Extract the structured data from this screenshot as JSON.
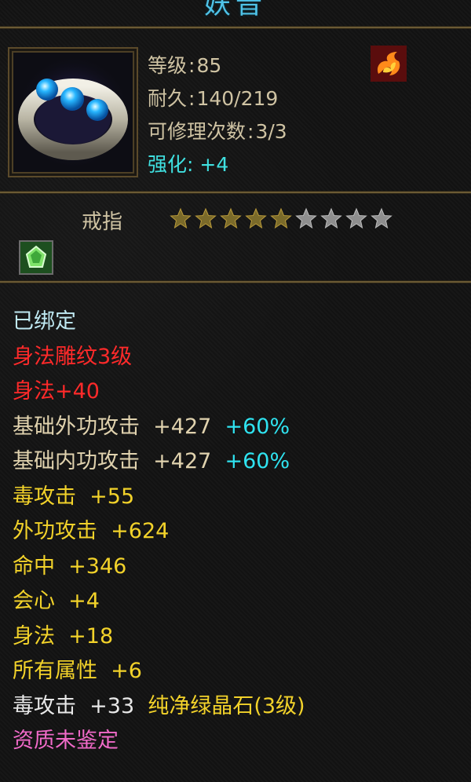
{
  "item": {
    "name": "妖音",
    "type": "戒指",
    "icon": "ring-with-blue-gems-icon",
    "emblem": "fire-element-icon",
    "gem_socket": "green-gem-icon",
    "stars": {
      "total": 9,
      "filled": 5
    },
    "stats": {
      "level_label": "等级",
      "level_value": "85",
      "durability_label": "耐久",
      "durability_value": "140/219",
      "repair_label": "可修理次数",
      "repair_value": "3/3",
      "refine_label": "强化:",
      "refine_value": "+4"
    }
  },
  "attributes": [
    {
      "parts": [
        {
          "text": "已绑定",
          "color": "lightcyan"
        }
      ]
    },
    {
      "parts": [
        {
          "text": "身法雕纹3级",
          "color": "red"
        }
      ]
    },
    {
      "parts": [
        {
          "text": "身法+40",
          "color": "red"
        }
      ]
    },
    {
      "parts": [
        {
          "text": "基础外功攻击",
          "color": "beige"
        },
        {
          "text": "  +427",
          "color": "beige"
        },
        {
          "text": "  +60%",
          "color": "cyan"
        }
      ]
    },
    {
      "parts": [
        {
          "text": "基础内功攻击",
          "color": "beige"
        },
        {
          "text": "  +427",
          "color": "beige"
        },
        {
          "text": "  +60%",
          "color": "cyan"
        }
      ]
    },
    {
      "parts": [
        {
          "text": "毒攻击",
          "color": "yellow"
        },
        {
          "text": "  +55",
          "color": "yellow"
        }
      ]
    },
    {
      "parts": [
        {
          "text": "外功攻击",
          "color": "yellow"
        },
        {
          "text": "  +624",
          "color": "yellow"
        }
      ]
    },
    {
      "parts": [
        {
          "text": "命中",
          "color": "yellow"
        },
        {
          "text": "  +346",
          "color": "yellow"
        }
      ]
    },
    {
      "parts": [
        {
          "text": "会心",
          "color": "yellow"
        },
        {
          "text": "  +4",
          "color": "yellow"
        }
      ]
    },
    {
      "parts": [
        {
          "text": "身法",
          "color": "yellow"
        },
        {
          "text": "  +18",
          "color": "yellow"
        }
      ]
    },
    {
      "parts": [
        {
          "text": "所有属性",
          "color": "yellow"
        },
        {
          "text": "  +6",
          "color": "yellow"
        }
      ]
    },
    {
      "parts": [
        {
          "text": "毒攻击",
          "color": "white"
        },
        {
          "text": "  +33",
          "color": "white"
        },
        {
          "text": "  纯净绿晶石(3级)",
          "color": "yellow"
        }
      ]
    },
    {
      "parts": [
        {
          "text": "资质未鉴定",
          "color": "pink"
        }
      ]
    }
  ]
}
